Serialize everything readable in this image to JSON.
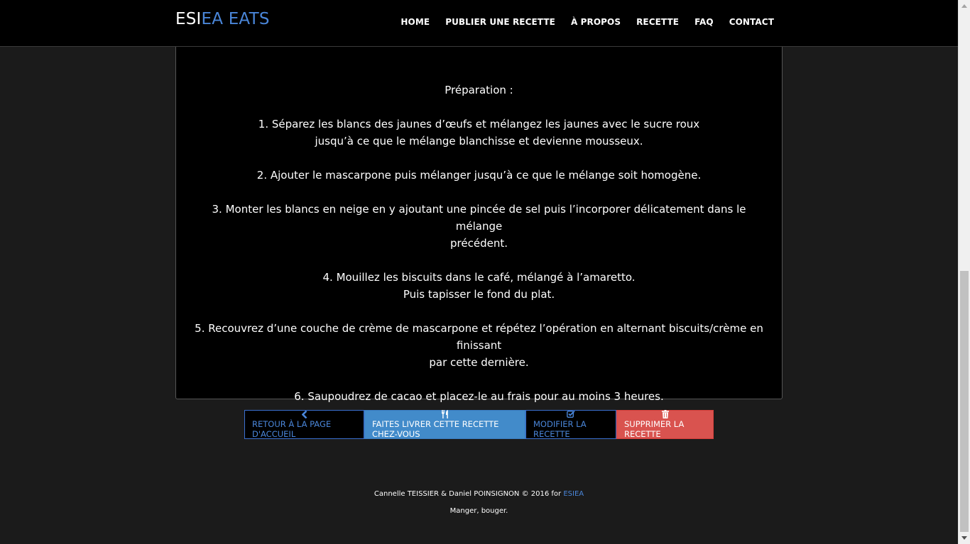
{
  "nav": {
    "brand_part1": "ESI",
    "brand_part2": "EA EATS",
    "links": [
      "HOME",
      "PUBLIER UNE RECETTE",
      "À PROPOS",
      "RECETTE",
      "FAQ",
      "CONTACT"
    ]
  },
  "recipe": {
    "preparation_title": "Préparation :",
    "steps": [
      [
        "1. Séparez les blancs des jaunes d’œufs et mélangez les jaunes avec le sucre roux",
        "jusqu’à ce que le mélange blanchisse et devienne mousseux."
      ],
      [
        "2. Ajouter le mascarpone puis mélanger jusqu’à ce que le mélange soit homogène."
      ],
      [
        "3. Monter les blancs en neige en y ajoutant une pincée de sel puis l’incorporer délicatement dans le mélange",
        "précédent."
      ],
      [
        "4. Mouillez les biscuits dans le café, mélangé à l’amaretto.",
        "Puis tapisser le fond du plat."
      ],
      [
        "5. Recouvrez d’une couche de crème de mascarpone et répétez l’opération en alternant biscuits/crème en finissant",
        "par cette dernière."
      ],
      [
        "6. Saupoudrez de cacao et placez-le au frais pour au moins 3 heures."
      ]
    ]
  },
  "actions": {
    "back_label": "Retour à la page d'accueil",
    "deliver_label": "Faites livrer cette recette chez-vous",
    "edit_label": "Modifier la recette",
    "delete_label": "Supprimer la recette",
    "back_icon": "chevron-left-icon",
    "deliver_icon": "cutlery-icon",
    "edit_icon": "edit-icon",
    "delete_icon": "trash-icon"
  },
  "footer": {
    "credit": "Cannelle TEISSIER & Daniel POINSIGNON © 2016 for",
    "credit_link": "ESIEA",
    "tagline": "Manger, bouger."
  },
  "colors": {
    "accent": "#4a86d9",
    "primary_button": "#428bca",
    "danger_button": "#d9534f",
    "background": "#1b1b1b",
    "panel": "#000000"
  }
}
